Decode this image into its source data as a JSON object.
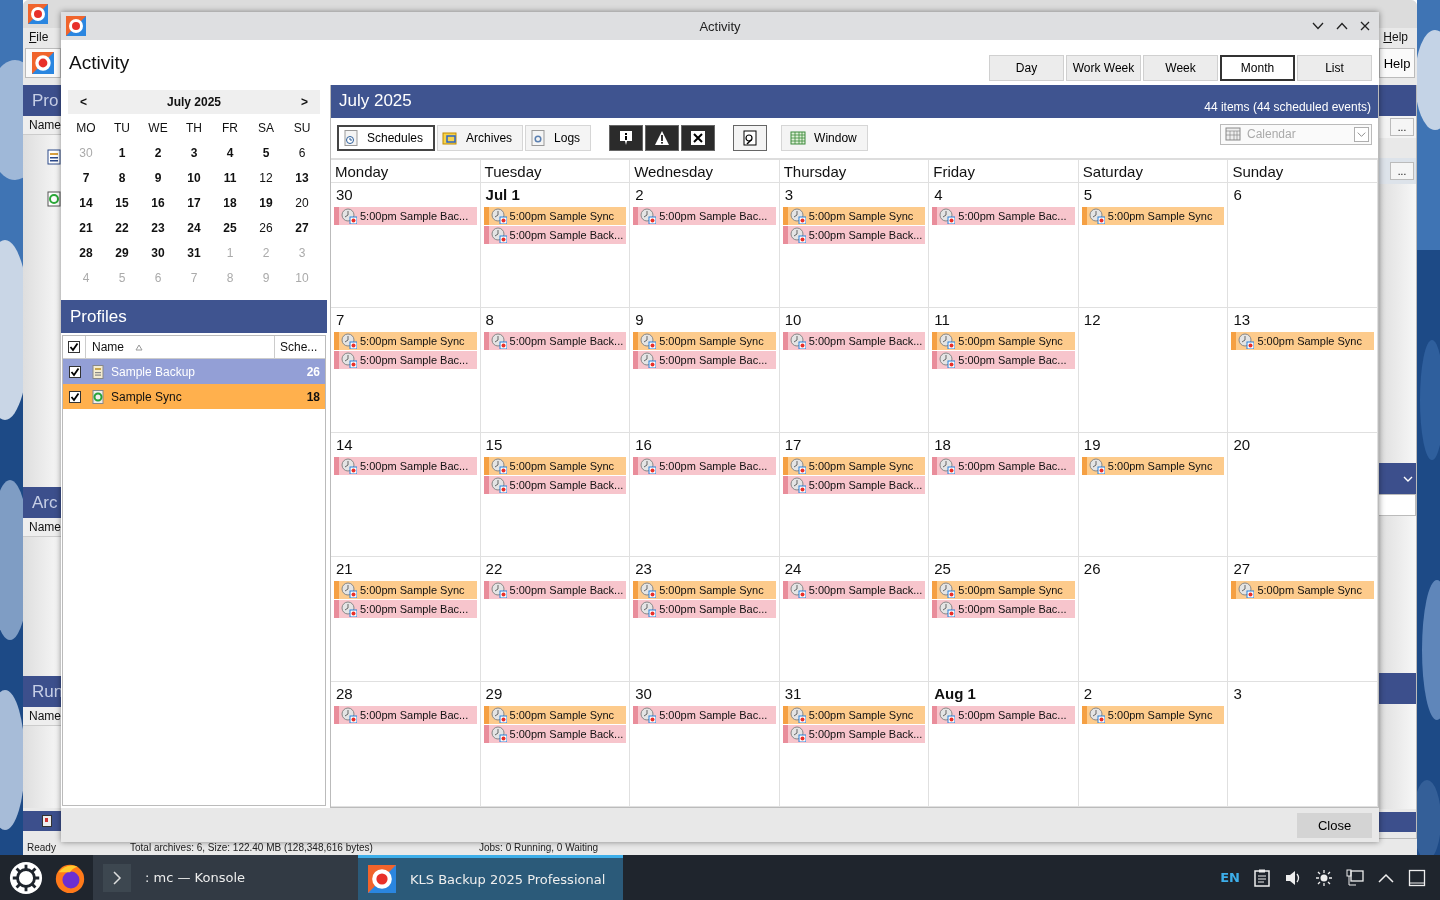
{
  "main_window": {
    "menus": [
      "File",
      "Help"
    ],
    "toolbar_button": "Help",
    "browse_buttons": [
      "...",
      "..."
    ],
    "sections": [
      {
        "title": "Pro",
        "column": "Name"
      },
      {
        "title": "Arc",
        "column": "Name"
      },
      {
        "title": "Run",
        "column": "Name"
      }
    ],
    "status_bar": [
      "Ready",
      "Total archives: 6, Size: 122.40 MB (128,348,616 bytes)",
      "Jobs: 0 Running, 0 Waiting"
    ]
  },
  "dialog": {
    "title": "Activity",
    "heading": "Activity",
    "views": [
      {
        "label": "Day",
        "selected": false
      },
      {
        "label": "Work Week",
        "selected": false
      },
      {
        "label": "Week",
        "selected": false
      },
      {
        "label": "Month",
        "selected": true
      },
      {
        "label": "List",
        "selected": false
      }
    ],
    "mini_calendar": {
      "prev": "<",
      "month": "July 2025",
      "next": ">",
      "weekdays": [
        "MO",
        "TU",
        "WE",
        "TH",
        "FR",
        "SA",
        "SU"
      ],
      "weeks": [
        [
          {
            "day": "30",
            "other_month": true,
            "has_events": false
          },
          {
            "day": "1",
            "other_month": false,
            "has_events": true
          },
          {
            "day": "2",
            "other_month": false,
            "has_events": true
          },
          {
            "day": "3",
            "other_month": false,
            "has_events": true
          },
          {
            "day": "4",
            "other_month": false,
            "has_events": true
          },
          {
            "day": "5",
            "other_month": false,
            "has_events": true
          },
          {
            "day": "6",
            "other_month": false,
            "has_events": false
          }
        ],
        [
          {
            "day": "7",
            "other_month": false,
            "has_events": true
          },
          {
            "day": "8",
            "other_month": false,
            "has_events": true
          },
          {
            "day": "9",
            "other_month": false,
            "has_events": true
          },
          {
            "day": "10",
            "other_month": false,
            "has_events": true
          },
          {
            "day": "11",
            "other_month": false,
            "has_events": true
          },
          {
            "day": "12",
            "other_month": false,
            "has_events": false
          },
          {
            "day": "13",
            "other_month": false,
            "has_events": true
          }
        ],
        [
          {
            "day": "14",
            "other_month": false,
            "has_events": true
          },
          {
            "day": "15",
            "other_month": false,
            "has_events": true
          },
          {
            "day": "16",
            "other_month": false,
            "has_events": true
          },
          {
            "day": "17",
            "other_month": false,
            "has_events": true
          },
          {
            "day": "18",
            "other_month": false,
            "has_events": true
          },
          {
            "day": "19",
            "other_month": false,
            "has_events": true
          },
          {
            "day": "20",
            "other_month": false,
            "has_events": false
          }
        ],
        [
          {
            "day": "21",
            "other_month": false,
            "has_events": true
          },
          {
            "day": "22",
            "other_month": false,
            "has_events": true
          },
          {
            "day": "23",
            "other_month": false,
            "has_events": true
          },
          {
            "day": "24",
            "other_month": false,
            "has_events": true
          },
          {
            "day": "25",
            "other_month": false,
            "has_events": true
          },
          {
            "day": "26",
            "other_month": false,
            "has_events": false
          },
          {
            "day": "27",
            "other_month": false,
            "has_events": true
          }
        ],
        [
          {
            "day": "28",
            "other_month": false,
            "has_events": true
          },
          {
            "day": "29",
            "other_month": false,
            "has_events": true
          },
          {
            "day": "30",
            "other_month": false,
            "has_events": true
          },
          {
            "day": "31",
            "other_month": false,
            "has_events": true
          },
          {
            "day": "1",
            "other_month": true,
            "has_events": false
          },
          {
            "day": "2",
            "other_month": true,
            "has_events": false
          },
          {
            "day": "3",
            "other_month": true,
            "has_events": false
          }
        ],
        [
          {
            "day": "4",
            "other_month": true,
            "has_events": false
          },
          {
            "day": "5",
            "other_month": true,
            "has_events": false
          },
          {
            "day": "6",
            "other_month": true,
            "has_events": false
          },
          {
            "day": "7",
            "other_month": true,
            "has_events": false
          },
          {
            "day": "8",
            "other_month": true,
            "has_events": false
          },
          {
            "day": "9",
            "other_month": true,
            "has_events": false
          },
          {
            "day": "10",
            "other_month": true,
            "has_events": false
          }
        ]
      ]
    },
    "profiles": {
      "title": "Profiles",
      "all_checked": true,
      "columns": [
        "Name",
        "Sche..."
      ],
      "rows": [
        {
          "name": "Sample Backup",
          "count": "26",
          "kind": "backup",
          "checked": true,
          "selected": true,
          "color": "#939fd6"
        },
        {
          "name": "Sample Sync",
          "count": "18",
          "kind": "sync",
          "checked": true,
          "selected": false,
          "color": "#ffb04d"
        }
      ]
    },
    "calendar": {
      "title": "July 2025",
      "summary": "44 items (44 scheduled events)",
      "tabs": [
        {
          "label": "Schedules",
          "kind": "schedules",
          "selected": true
        },
        {
          "label": "Archives",
          "kind": "archives",
          "selected": false
        },
        {
          "label": "Logs",
          "kind": "logs",
          "selected": false
        }
      ],
      "filters": [
        {
          "kind": "info",
          "on": true
        },
        {
          "kind": "warning",
          "on": true
        },
        {
          "kind": "error",
          "on": true
        }
      ],
      "window_button": "Window",
      "view_select": {
        "value": "Calendar",
        "disabled": true
      },
      "weekdays": [
        "Monday",
        "Tuesday",
        "Wednesday",
        "Thursday",
        "Friday",
        "Saturday",
        "Sunday"
      ],
      "weeks": [
        [
          {
            "label": "30",
            "bold": false,
            "events": [
              {
                "kind": "backup",
                "text": "5:00pm Sample Bac..."
              }
            ]
          },
          {
            "label": "Jul 1",
            "bold": true,
            "events": [
              {
                "kind": "sync",
                "text": "5:00pm Sample Sync"
              },
              {
                "kind": "backup",
                "text": "5:00pm Sample Back..."
              }
            ]
          },
          {
            "label": "2",
            "bold": false,
            "events": [
              {
                "kind": "backup",
                "text": "5:00pm Sample Bac..."
              }
            ]
          },
          {
            "label": "3",
            "bold": false,
            "events": [
              {
                "kind": "sync",
                "text": "5:00pm Sample Sync"
              },
              {
                "kind": "backup",
                "text": "5:00pm Sample Back..."
              }
            ]
          },
          {
            "label": "4",
            "bold": false,
            "events": [
              {
                "kind": "backup",
                "text": "5:00pm Sample Bac..."
              }
            ]
          },
          {
            "label": "5",
            "bold": false,
            "events": [
              {
                "kind": "sync",
                "text": "5:00pm Sample Sync"
              }
            ]
          },
          {
            "label": "6",
            "bold": false
          }
        ],
        [
          {
            "label": "7",
            "bold": false,
            "events": [
              {
                "kind": "sync",
                "text": "5:00pm Sample Sync"
              },
              {
                "kind": "backup",
                "text": "5:00pm Sample Bac..."
              }
            ]
          },
          {
            "label": "8",
            "bold": false,
            "events": [
              {
                "kind": "backup",
                "text": "5:00pm Sample Back..."
              }
            ]
          },
          {
            "label": "9",
            "bold": false,
            "events": [
              {
                "kind": "sync",
                "text": "5:00pm Sample Sync"
              },
              {
                "kind": "backup",
                "text": "5:00pm Sample Bac..."
              }
            ]
          },
          {
            "label": "10",
            "bold": false,
            "events": [
              {
                "kind": "backup",
                "text": "5:00pm Sample Back..."
              }
            ]
          },
          {
            "label": "11",
            "bold": false,
            "events": [
              {
                "kind": "sync",
                "text": "5:00pm Sample Sync"
              },
              {
                "kind": "backup",
                "text": "5:00pm Sample Bac..."
              }
            ]
          },
          {
            "label": "12",
            "bold": false
          },
          {
            "label": "13",
            "bold": false,
            "events": [
              {
                "kind": "sync",
                "text": "5:00pm Sample Sync"
              }
            ]
          }
        ],
        [
          {
            "label": "14",
            "bold": false,
            "events": [
              {
                "kind": "backup",
                "text": "5:00pm Sample Bac..."
              }
            ]
          },
          {
            "label": "15",
            "bold": false,
            "events": [
              {
                "kind": "sync",
                "text": "5:00pm Sample Sync"
              },
              {
                "kind": "backup",
                "text": "5:00pm Sample Back..."
              }
            ]
          },
          {
            "label": "16",
            "bold": false,
            "events": [
              {
                "kind": "backup",
                "text": "5:00pm Sample Bac..."
              }
            ]
          },
          {
            "label": "17",
            "bold": false,
            "events": [
              {
                "kind": "sync",
                "text": "5:00pm Sample Sync"
              },
              {
                "kind": "backup",
                "text": "5:00pm Sample Back..."
              }
            ]
          },
          {
            "label": "18",
            "bold": false,
            "events": [
              {
                "kind": "backup",
                "text": "5:00pm Sample Bac..."
              }
            ]
          },
          {
            "label": "19",
            "bold": false,
            "events": [
              {
                "kind": "sync",
                "text": "5:00pm Sample Sync"
              }
            ]
          },
          {
            "label": "20",
            "bold": false
          }
        ],
        [
          {
            "label": "21",
            "bold": false,
            "events": [
              {
                "kind": "sync",
                "text": "5:00pm Sample Sync"
              },
              {
                "kind": "backup",
                "text": "5:00pm Sample Bac..."
              }
            ]
          },
          {
            "label": "22",
            "bold": false,
            "events": [
              {
                "kind": "backup",
                "text": "5:00pm Sample Back..."
              }
            ]
          },
          {
            "label": "23",
            "bold": false,
            "events": [
              {
                "kind": "sync",
                "text": "5:00pm Sample Sync"
              },
              {
                "kind": "backup",
                "text": "5:00pm Sample Bac..."
              }
            ]
          },
          {
            "label": "24",
            "bold": false,
            "events": [
              {
                "kind": "backup",
                "text": "5:00pm Sample Back..."
              }
            ]
          },
          {
            "label": "25",
            "bold": false,
            "events": [
              {
                "kind": "sync",
                "text": "5:00pm Sample Sync"
              },
              {
                "kind": "backup",
                "text": "5:00pm Sample Bac..."
              }
            ]
          },
          {
            "label": "26",
            "bold": false
          },
          {
            "label": "27",
            "bold": false,
            "events": [
              {
                "kind": "sync",
                "text": "5:00pm Sample Sync"
              }
            ]
          }
        ],
        [
          {
            "label": "28",
            "bold": false,
            "events": [
              {
                "kind": "backup",
                "text": "5:00pm Sample Bac..."
              }
            ]
          },
          {
            "label": "29",
            "bold": false,
            "events": [
              {
                "kind": "sync",
                "text": "5:00pm Sample Sync"
              },
              {
                "kind": "backup",
                "text": "5:00pm Sample Back..."
              }
            ]
          },
          {
            "label": "30",
            "bold": false,
            "events": [
              {
                "kind": "backup",
                "text": "5:00pm Sample Bac..."
              }
            ]
          },
          {
            "label": "31",
            "bold": false,
            "events": [
              {
                "kind": "sync",
                "text": "5:00pm Sample Sync"
              },
              {
                "kind": "backup",
                "text": "5:00pm Sample Back..."
              }
            ]
          },
          {
            "label": "Aug 1",
            "bold": true,
            "events": [
              {
                "kind": "backup",
                "text": "5:00pm Sample Bac..."
              }
            ]
          },
          {
            "label": "2",
            "bold": false,
            "events": [
              {
                "kind": "sync",
                "text": "5:00pm Sample Sync"
              }
            ]
          },
          {
            "label": "3",
            "bold": false
          }
        ]
      ]
    },
    "close_button": "Close"
  },
  "taskbar": {
    "tasks": [
      {
        "label": ": mc — Konsole",
        "kind": "terminal",
        "selected": false
      },
      {
        "label": "KLS Backup 2025 Professional",
        "kind": "app",
        "selected": true
      }
    ],
    "language": "EN"
  }
}
